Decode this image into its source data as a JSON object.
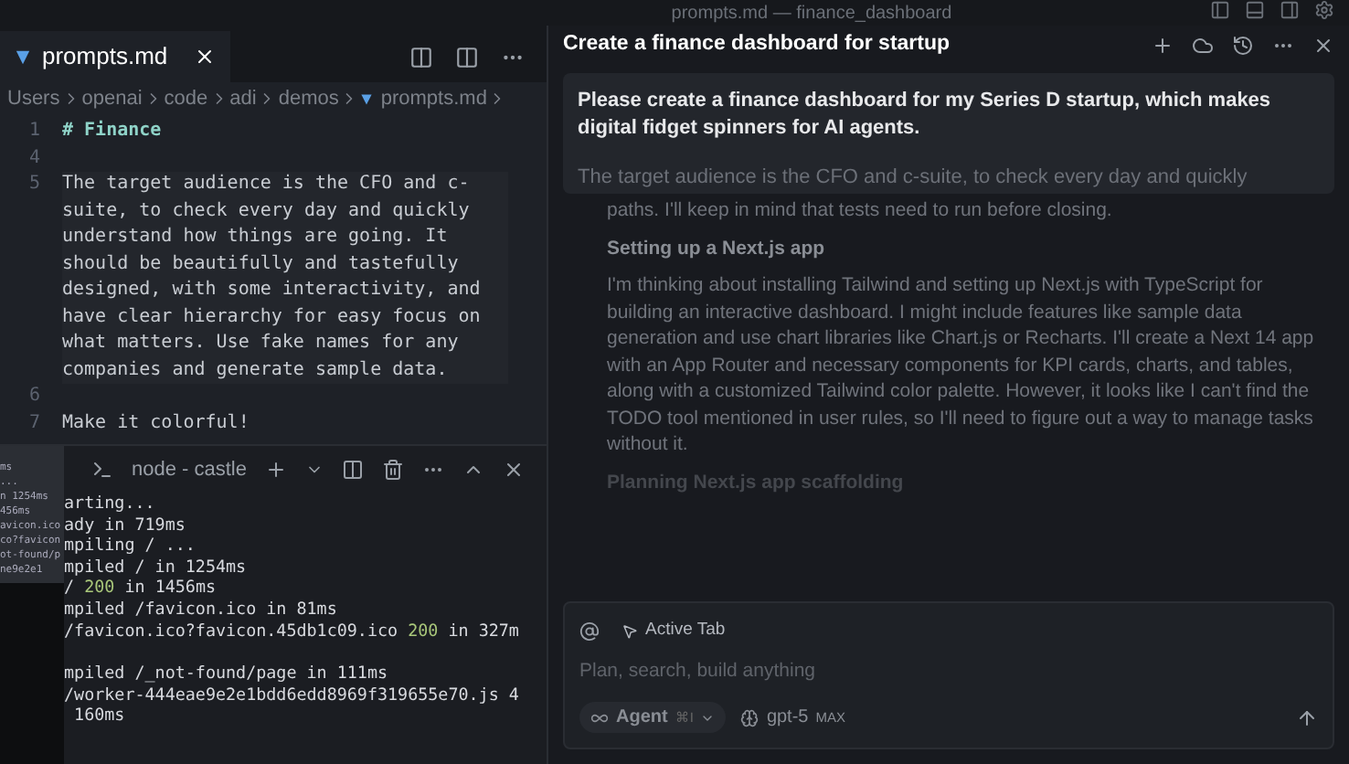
{
  "window": {
    "title": "prompts.md — finance_dashboard"
  },
  "editor": {
    "tabs": [
      {
        "label": "prompts.md",
        "selected": true
      }
    ],
    "breadcrumb": [
      "Users",
      "openai",
      "code",
      "adi",
      "demos",
      "prompts.md"
    ],
    "lines": [
      {
        "number": "1",
        "kind": "heading",
        "text": "# Finance"
      },
      {
        "number": "4",
        "kind": "text"
      },
      {
        "number": "5",
        "kind": "text",
        "text": "The target audience is the CFO and c-suite, to check every day and quickly understand how things are going. It should be beautifully and tastefully designed, with some interactivity, and have clear hierarchy for easy focus on what matters.  Use fake names for any companies and generate sample data."
      },
      {
        "number": "6",
        "kind": "text"
      },
      {
        "number": "7",
        "kind": "text",
        "text": "Make it colorful!"
      }
    ]
  },
  "side_terminal": {
    "lines": [
      "ms",
      "...",
      "n 1254ms",
      "456ms",
      "avicon.ico",
      "co?favicon",
      "ot-found/p",
      "ne9e2e1"
    ]
  },
  "terminal": {
    "title": "node - castle",
    "lines": [
      {
        "text": "arting..."
      },
      {
        "text": "ady in 719ms"
      },
      {
        "text": "mpiling / ..."
      },
      {
        "text": "mpiled / in 1254ms"
      },
      {
        "text": "/ ",
        "status": "200",
        "rest": " in 1456ms"
      },
      {
        "text": "mpiled /favicon.ico in 81ms"
      },
      {
        "text": "/favicon.ico?favicon.45db1c09.ico ",
        "status": "200",
        "rest": " in 327m"
      },
      {
        "text": "mpiled /_not-found/page in 111ms"
      },
      {
        "text": "/worker-444eae9e2e1bdd6edd8969f319655e70.js 4"
      },
      {
        "text": " 160ms"
      }
    ]
  },
  "chat": {
    "title": "Create a finance dashboard for startup",
    "message": "Please create a finance dashboard for my Series D startup, which makes digital fidget spinners for AI agents.",
    "message_more": "The target audience is the CFO and c-suite, to check every day and quickly",
    "thinking": [
      {
        "kind": "text",
        "text": "paths. I'll keep in mind that tests need to run before closing."
      },
      {
        "kind": "heading",
        "text": "Setting up a Next.js app"
      },
      {
        "kind": "text",
        "text": "I'm thinking about installing Tailwind and setting up Next.js with TypeScript for building an interactive dashboard. I might include features like sample data generation and use chart libraries like Chart.js or Recharts. I'll create a Next 14 app with an App Router and necessary components for KPI cards, charts, and tables, along with a customized Tailwind color palette. However, it looks like I can't find the TODO tool mentioned in user rules, so I'll need to figure out a way to manage tasks without it."
      },
      {
        "kind": "faded",
        "text": "Planning Next.js app scaffolding"
      }
    ],
    "context_chip": "Active Tab",
    "input": {
      "placeholder": "Plan, search, build anything"
    },
    "mode": {
      "label": "Agent",
      "shortcut": "⌘I"
    },
    "model": {
      "label": "gpt-5",
      "badge": "MAX"
    }
  }
}
